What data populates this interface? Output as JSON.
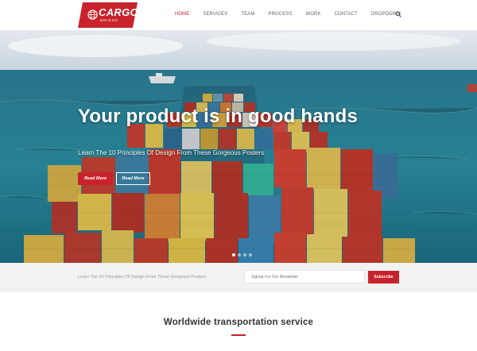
{
  "brand": {
    "name": "CARGO",
    "subtitle": "BRIDGE",
    "accent_color": "#c8232c"
  },
  "nav": {
    "items": [
      {
        "label": "HOME",
        "active": true
      },
      {
        "label": "SERVICES",
        "active": false
      },
      {
        "label": "TEAM",
        "active": false
      },
      {
        "label": "PROCESS",
        "active": false
      },
      {
        "label": "WORK",
        "active": false
      },
      {
        "label": "CONTACT",
        "active": false
      },
      {
        "label": "DROPDOWN",
        "active": false
      }
    ],
    "search_icon": "search-icon"
  },
  "hero": {
    "title": "Your product is in good hands",
    "subtitle": "Learn The 10 Principles Of Design From These Gorgeous Posters",
    "primary_button": "Read More",
    "secondary_button": "Read More",
    "slides": 4,
    "active_slide": 1
  },
  "newsletter": {
    "text": "Learn The 10 Principles Of Design From These Gorgeous Posters",
    "placeholder": "Signup For Our Newsletter",
    "button": "Subscribe"
  },
  "section": {
    "title": "Worldwide transportation service"
  }
}
